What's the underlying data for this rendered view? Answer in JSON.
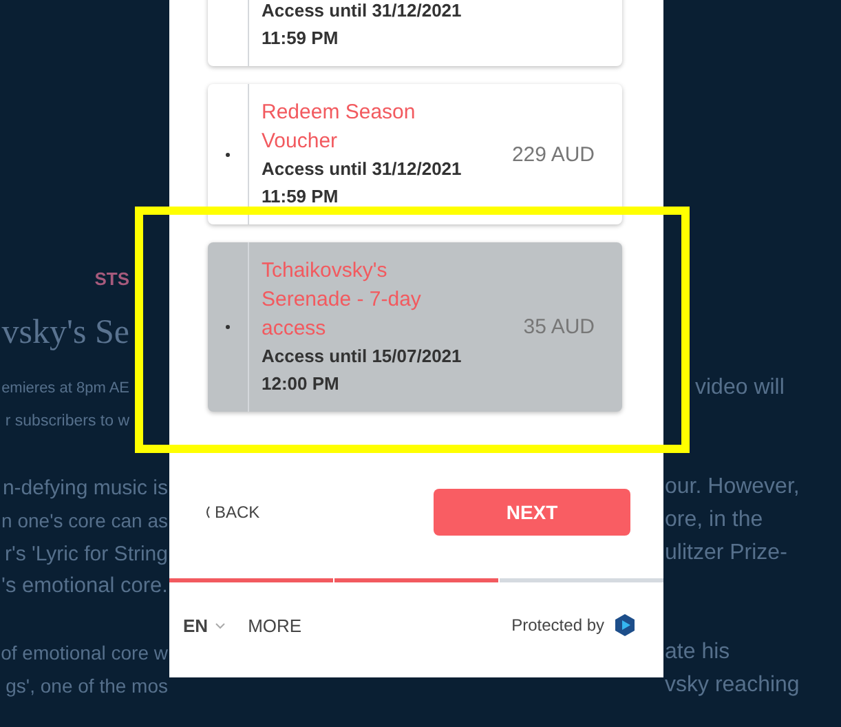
{
  "background_page": {
    "rows": [
      {
        "kind": "eyebrow",
        "left": "STS"
      },
      {
        "kind": "heading",
        "left": "vsky's Se"
      },
      {
        "kind": "body",
        "left": "emieres at 8pm AE",
        "right": "video will"
      },
      {
        "kind": "body",
        "left": "r subscribers to w"
      },
      {
        "kind": "gap"
      },
      {
        "kind": "body",
        "left": "n-defying music is",
        "right": "our. However,"
      },
      {
        "kind": "body",
        "left": "n one's core can as",
        "right": "ore, in the"
      },
      {
        "kind": "body",
        "left": "r's 'Lyric for String",
        "right": "ulitzer Prize-"
      },
      {
        "kind": "body",
        "left": "'s emotional core."
      },
      {
        "kind": "gap"
      },
      {
        "kind": "body",
        "left": "of emotional core w",
        "right": "ate his"
      },
      {
        "kind": "body",
        "left": "gs', one of the mos",
        "right": "vsky reaching"
      }
    ]
  },
  "modal": {
    "options": [
      {
        "access": "Access until 31/12/2021 11:59 PM",
        "selected": false
      },
      {
        "title": "Redeem Season Voucher",
        "access": "Access until 31/12/2021 11:59 PM",
        "price": "229 AUD",
        "selected": false
      },
      {
        "title": "Tchaikovsky's Serenade - 7-day access",
        "access": "Access until 15/07/2021 12:00 PM",
        "price": "35 AUD",
        "selected": true
      }
    ],
    "back_label": "BACK",
    "next_label": "NEXT",
    "progress": [
      {
        "done": true
      },
      {
        "done": true
      },
      {
        "done": false
      }
    ],
    "footer": {
      "language": "EN",
      "more": "MORE",
      "protected_by": "Protected by"
    }
  },
  "highlight": {
    "shown": true
  }
}
